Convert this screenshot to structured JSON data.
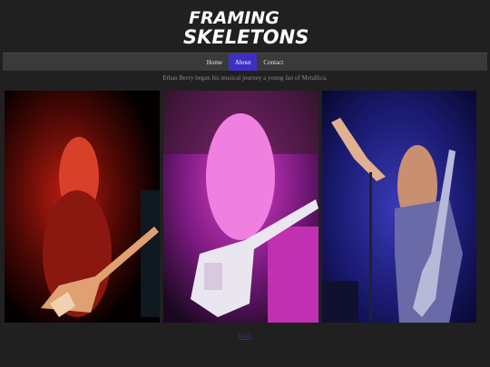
{
  "logo": {
    "line1": "FRAMING",
    "line2": "SKELETONS"
  },
  "nav": {
    "items": [
      {
        "label": "Home"
      },
      {
        "label": "About"
      },
      {
        "label": "Contact"
      }
    ]
  },
  "caption": "Ethan Berry began his musical journey a young fan of Metallica.",
  "footer": {
    "link": "Back"
  },
  "colors": {
    "background": "#202020",
    "nav": "#3a3a3a",
    "active": "#3d2fc4"
  }
}
